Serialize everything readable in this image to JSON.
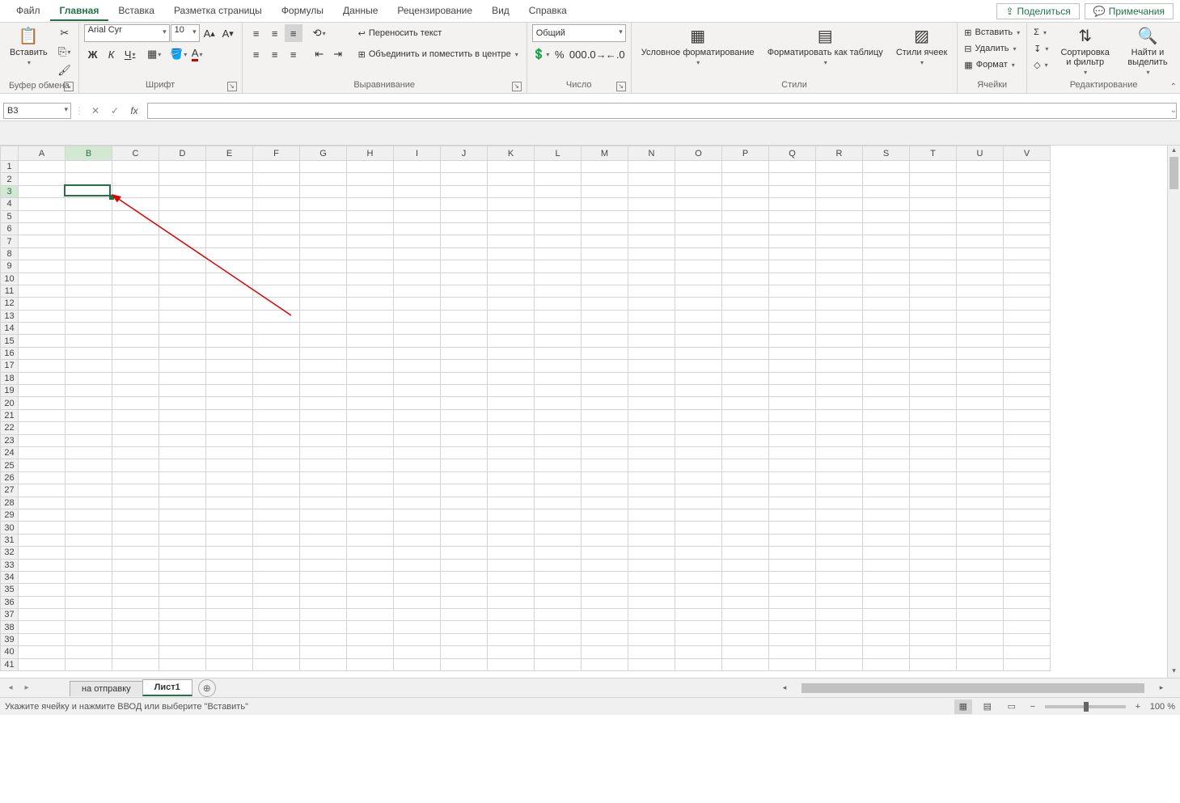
{
  "menu": {
    "tabs": [
      "Файл",
      "Главная",
      "Вставка",
      "Разметка страницы",
      "Формулы",
      "Данные",
      "Рецензирование",
      "Вид",
      "Справка"
    ],
    "active": 1,
    "share": "Поделиться",
    "comments": "Примечания"
  },
  "ribbon": {
    "clipboard": {
      "label": "Буфер обмена",
      "paste": "Вставить"
    },
    "font": {
      "label": "Шрифт",
      "name": "Arial Cyr",
      "size": "10",
      "bold": "Ж",
      "italic": "К",
      "underline": "Ч"
    },
    "alignment": {
      "label": "Выравнивание",
      "wrap": "Переносить текст",
      "merge": "Объединить и поместить в центре"
    },
    "number": {
      "label": "Число",
      "format": "Общий"
    },
    "styles": {
      "label": "Стили",
      "cond": "Условное форматирование",
      "table": "Форматировать как таблицу",
      "cell": "Стили ячеек"
    },
    "cells": {
      "label": "Ячейки",
      "insert": "Вставить",
      "delete": "Удалить",
      "format": "Формат"
    },
    "editing": {
      "label": "Редактирование",
      "sort": "Сортировка и фильтр",
      "find": "Найти и выделить"
    }
  },
  "formula_bar": {
    "name_box": "B3"
  },
  "grid": {
    "columns": [
      "A",
      "B",
      "C",
      "D",
      "E",
      "F",
      "G",
      "H",
      "I",
      "J",
      "K",
      "L",
      "M",
      "N",
      "O",
      "P",
      "Q",
      "R",
      "S",
      "T",
      "U",
      "V"
    ],
    "rows": 41,
    "active_cell": "B3",
    "active_col_index": 1,
    "active_row_index": 2
  },
  "sheets": {
    "tabs": [
      "на отправку",
      "Лист1"
    ],
    "active": 1
  },
  "status": {
    "message": "Укажите ячейку и нажмите ВВОД или выберите \"Вставить\"",
    "zoom": "100 %"
  }
}
